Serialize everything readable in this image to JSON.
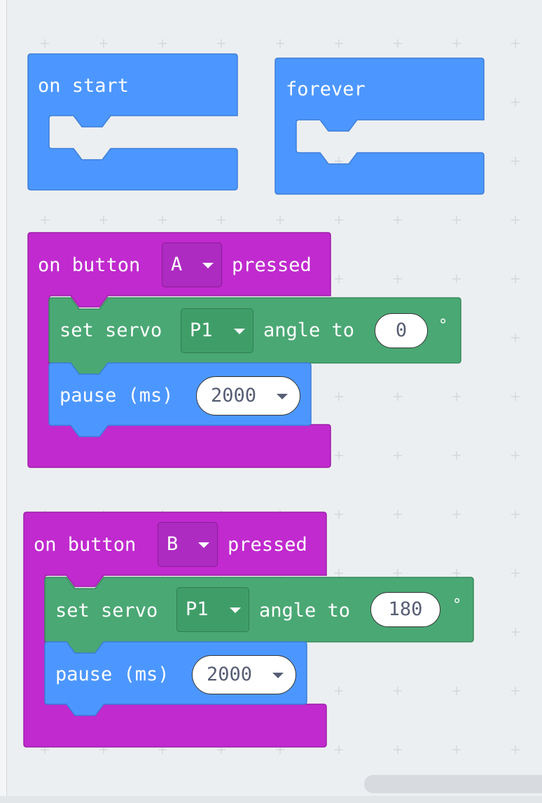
{
  "colors": {
    "workspace_bg": "#eceff1",
    "basic_block": "#4c97ff",
    "input_block": "#c02ace",
    "servo_block": "#4aa874",
    "grid_plus": "#d4d8dc"
  },
  "blocks": {
    "on_start": {
      "label": "on start"
    },
    "forever": {
      "label": "forever"
    },
    "button_a": {
      "label_on": "on button",
      "button": "A",
      "label_pressed": "pressed",
      "servo": {
        "label_set": "set servo",
        "pin": "P1",
        "label_angle": "angle to",
        "angle": "0",
        "degree": "°"
      },
      "pause": {
        "label": "pause (ms)",
        "value": "2000"
      }
    },
    "button_b": {
      "label_on": "on button",
      "button": "B",
      "label_pressed": "pressed",
      "servo": {
        "label_set": "set servo",
        "pin": "P1",
        "label_angle": "angle to",
        "angle": "180",
        "degree": "°"
      },
      "pause": {
        "label": "pause (ms)",
        "value": "2000"
      }
    }
  }
}
